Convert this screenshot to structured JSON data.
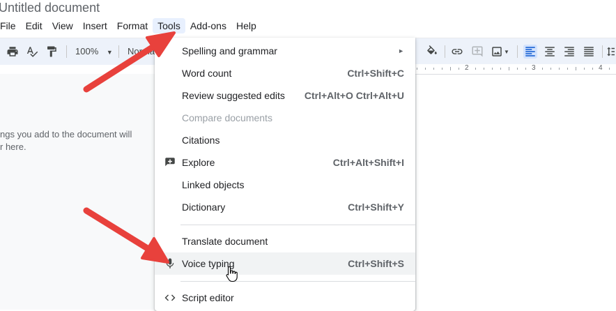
{
  "document": {
    "title": "Untitled document"
  },
  "menubar": {
    "items": [
      "File",
      "Edit",
      "View",
      "Insert",
      "Format",
      "Tools",
      "Add-ons",
      "Help"
    ],
    "active": "Tools"
  },
  "toolbar": {
    "zoom": "100%",
    "style": "Normal"
  },
  "ruler": {
    "numbers": [
      "2",
      "3",
      "4"
    ]
  },
  "outline": {
    "line1": "ngs you add to the document will",
    "line2": "r here."
  },
  "tools_menu": {
    "spelling": {
      "label": "Spelling and grammar"
    },
    "word_count": {
      "label": "Word count",
      "shortcut": "Ctrl+Shift+C"
    },
    "review": {
      "label": "Review suggested edits",
      "shortcut": "Ctrl+Alt+O Ctrl+Alt+U"
    },
    "compare": {
      "label": "Compare documents"
    },
    "citations": {
      "label": "Citations"
    },
    "explore": {
      "label": "Explore",
      "shortcut": "Ctrl+Alt+Shift+I"
    },
    "linked": {
      "label": "Linked objects"
    },
    "dictionary": {
      "label": "Dictionary",
      "shortcut": "Ctrl+Shift+Y"
    },
    "translate": {
      "label": "Translate document"
    },
    "voice": {
      "label": "Voice typing",
      "shortcut": "Ctrl+Shift+S"
    },
    "script": {
      "label": "Script editor"
    }
  },
  "colors": {
    "arrow": "#e8413c",
    "active_menu_bg": "#e8f0fe",
    "toolbar_bg": "#edf2fa",
    "accent": "#1a73e8"
  }
}
